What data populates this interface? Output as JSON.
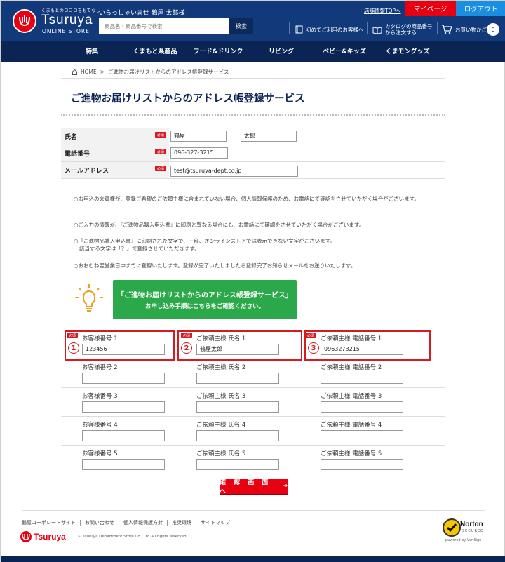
{
  "header": {
    "tagline": "くまもとのココロをもてなし",
    "brand": "Tsuruya",
    "brand_sub": "ONLINE STORE",
    "welcome": "いらっしゃいませ 鶴屋 太郎様",
    "search_placeholder": "商品名・商品番号で検索",
    "search_button": "検索",
    "store_info_link": "店舗情報TOPへ",
    "mypage": "マイページ",
    "logout": "ログアウト",
    "first_time": "初めてご利用のお客様へ",
    "catalog_line1": "カタログの商品番号",
    "catalog_line2": "から注文する",
    "cart": "お買い物かご",
    "cart_count": "0"
  },
  "nav": [
    "特集",
    "くまもと県産品",
    "フード&ドリンク",
    "リビング",
    "ベビー&キッズ",
    "くまモングッズ"
  ],
  "breadcrumb": {
    "home": "HOME",
    "sep": ">",
    "current": "ご進物お届けリストからのアドレス帳登録サービス"
  },
  "page_title": "ご進物お届けリストからのアドレス帳登録サービス",
  "required_label": "必須",
  "form": {
    "name_label": "氏名",
    "last_name": "鶴屋",
    "first_name": "太郎",
    "phone_label": "電話番号",
    "phone": "096-327-3215",
    "email_label": "メールアドレス",
    "email": "test@tsuruya-dept.co.jp"
  },
  "notes": [
    "○お申込の会員様が、登録ご希望のご依頼主様に含まれていない場合、個人情報保護のため、お電話にて確認をさせていただく場合がございます。",
    "○ご入力の情報が、『ご進物品購入申込書』に印刷と異なる場合にも、お電話にて確認をさせていただく場合がございます。",
    "○『ご進物品購入申込書』に印刷された文字で、一部、オンラインストアでは表示できない文字がございます。",
    "該当する文字は「？」で登録させていただきます。",
    "○おおむね翌営業日中までに登録いたします。登録が完了いたしましたら登録完了お知らせメールをお送りいたします。"
  ],
  "guide_button": {
    "line1": "「ご進物お届けリストからのアドレス帳登録サービス」",
    "line2": "お申し込み手順はこちらをご確認ください。"
  },
  "grid": {
    "markers": [
      "1",
      "2",
      "3"
    ],
    "rows": [
      {
        "customer_label": "お客様番号 1",
        "customer": "123456",
        "name_label": "ご依頼主様 氏名 1",
        "name": "鶴屋太郎",
        "phone_label": "ご依頼主様 電話番号 1",
        "phone": "0963273215"
      },
      {
        "customer_label": "お客様番号 2",
        "customer": "",
        "name_label": "ご依頼主様 氏名 2",
        "name": "",
        "phone_label": "ご依頼主様 電話番号 2",
        "phone": ""
      },
      {
        "customer_label": "お客様番号 3",
        "customer": "",
        "name_label": "ご依頼主様 氏名 3",
        "name": "",
        "phone_label": "ご依頼主様 電話番号 3",
        "phone": ""
      },
      {
        "customer_label": "お客様番号 4",
        "customer": "",
        "name_label": "ご依頼主様 氏名 4",
        "name": "",
        "phone_label": "ご依頼主様 電話番号 4",
        "phone": ""
      },
      {
        "customer_label": "お客様番号 5",
        "customer": "",
        "name_label": "ご依頼主様 氏名 5",
        "name": "",
        "phone_label": "ご依頼主様 電話番号 5",
        "phone": ""
      }
    ]
  },
  "confirm_button": "確 認 画 面 へ",
  "footer": {
    "links": [
      "鶴屋コーポレートサイト",
      "お問い合わせ",
      "個人情報保護方針",
      "推奨環境",
      "サイトマップ"
    ],
    "logo_text": "Tsuruya",
    "copyright": "© Tsuruya Department Store Co., Ltd All rights reserved.",
    "norton": "Norton",
    "norton_sub": "SECURED",
    "norton_powered": "powered by VeriSign"
  }
}
